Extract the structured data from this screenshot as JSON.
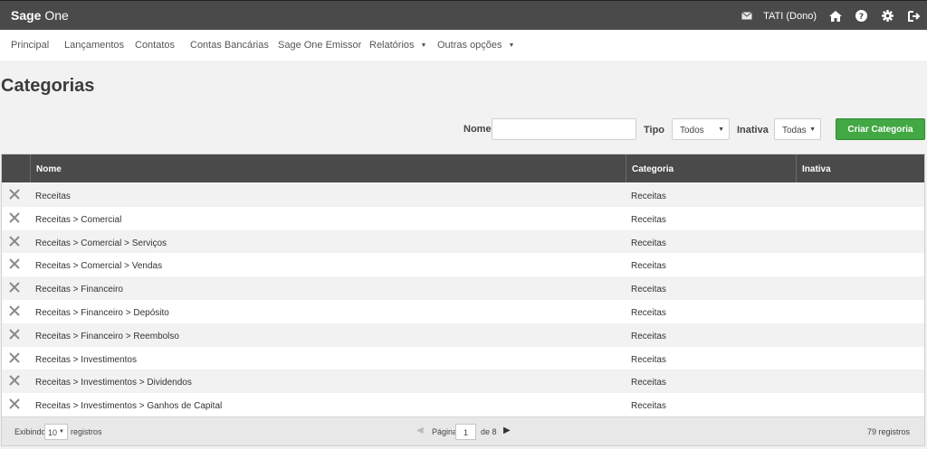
{
  "topbar": {
    "logo_bold": "Sage",
    "logo_rest": "One",
    "user": "TATI (Dono)",
    "icons": [
      "mail-icon",
      "home-icon",
      "help-icon",
      "gear-icon",
      "logout-icon"
    ]
  },
  "nav": {
    "items": [
      {
        "label": "Principal"
      },
      {
        "label": "Lançamentos"
      },
      {
        "label": "Contatos"
      },
      {
        "label": "Contas Bancárias"
      },
      {
        "label": "Sage One Emissor"
      },
      {
        "label": "Relatórios"
      },
      {
        "label": "Outras opções"
      }
    ]
  },
  "page": {
    "title": "Categorias"
  },
  "filters": {
    "nome_label": "Nome",
    "nome_value": "",
    "tipo_label": "Tipo",
    "tipo_value": "Todos",
    "inativa_label": "Inativa",
    "inativa_value": "Todas",
    "create_button": "Criar Categoria"
  },
  "table": {
    "columns": [
      "Nome",
      "Categoria",
      "Inativa"
    ],
    "rows": [
      {
        "nome": "Receitas",
        "categoria": "Receitas",
        "inativa": ""
      },
      {
        "nome": "Receitas > Comercial",
        "categoria": "Receitas",
        "inativa": ""
      },
      {
        "nome": "Receitas > Comercial > Serviços",
        "categoria": "Receitas",
        "inativa": ""
      },
      {
        "nome": "Receitas > Comercial > Vendas",
        "categoria": "Receitas",
        "inativa": ""
      },
      {
        "nome": "Receitas > Financeiro",
        "categoria": "Receitas",
        "inativa": ""
      },
      {
        "nome": "Receitas > Financeiro > Depósito",
        "categoria": "Receitas",
        "inativa": ""
      },
      {
        "nome": "Receitas > Financeiro > Reembolso",
        "categoria": "Receitas",
        "inativa": ""
      },
      {
        "nome": "Receitas > Investimentos",
        "categoria": "Receitas",
        "inativa": ""
      },
      {
        "nome": "Receitas > Investimentos > Dividendos",
        "categoria": "Receitas",
        "inativa": ""
      },
      {
        "nome": "Receitas > Investimentos > Ganhos de Capital",
        "categoria": "Receitas",
        "inativa": ""
      }
    ]
  },
  "pagination": {
    "showing_label": "Exibindo",
    "page_size": "10",
    "records_label": "registros",
    "page_label": "Página",
    "current_page": "1",
    "of_label": "de 8",
    "total": "79 registros"
  },
  "colors": {
    "topbar": "#4a4a4a",
    "accent_green": "#41a844",
    "table_header": "#4a4a4a"
  }
}
